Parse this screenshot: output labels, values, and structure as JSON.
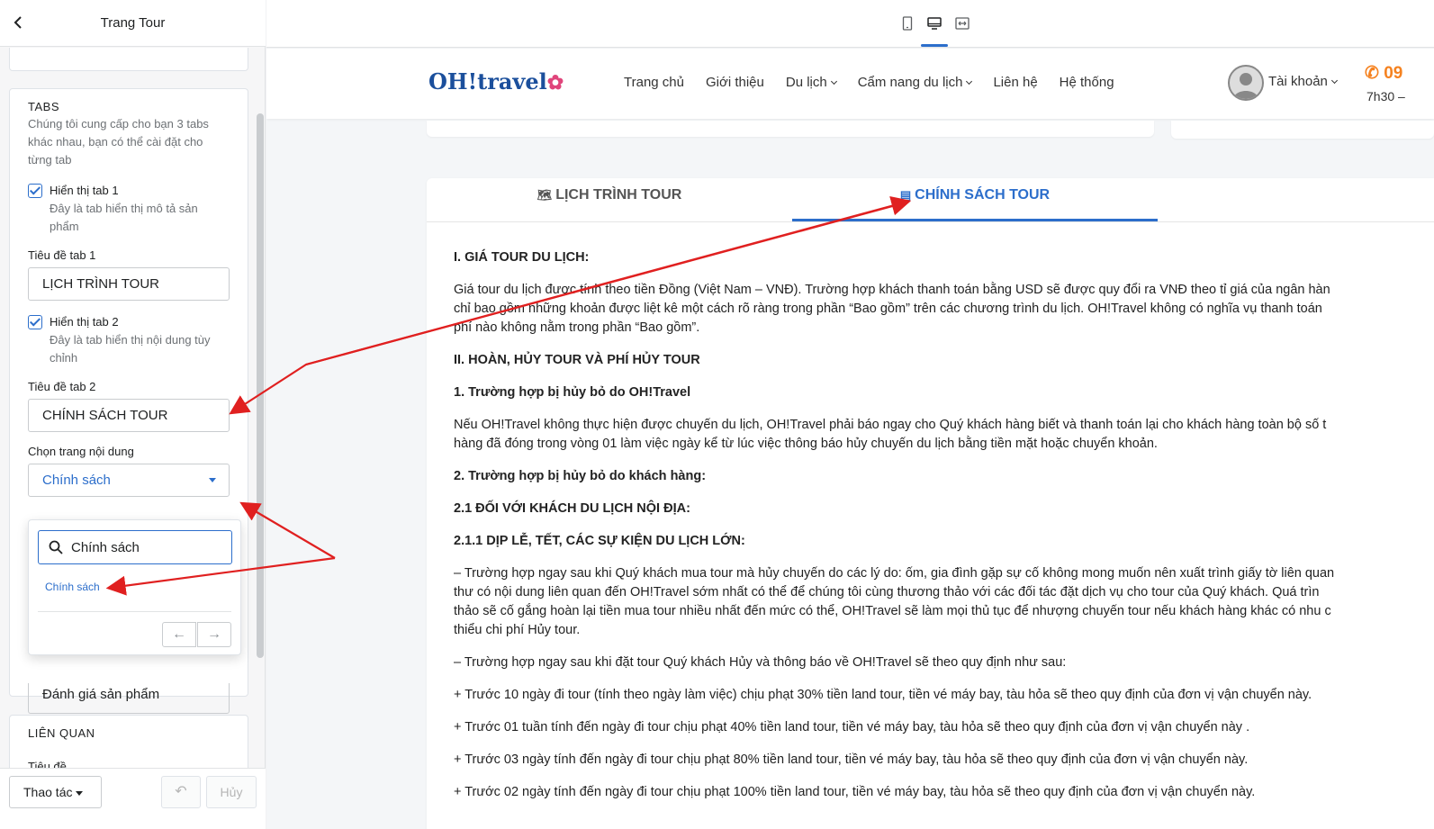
{
  "editor": {
    "title": "Trang Tour",
    "tabs_section": {
      "title": "TABS",
      "help": "Chúng tôi cung cấp cho bạn 3 tabs khác nhau, bạn có thể cài đặt cho từng tab",
      "tab1_checkbox_label": "Hiển thị tab 1",
      "tab1_checkbox_help": "Đây là tab hiển thị mô tả sản phẩm",
      "tab1_title_label": "Tiêu đề tab 1",
      "tab1_title_value": "LỊCH TRÌNH TOUR",
      "tab2_checkbox_label": "Hiển thị tab 2",
      "tab2_checkbox_help": "Đây là tab hiển thị nội dung tùy chỉnh",
      "tab2_title_label": "Tiêu đề tab 2",
      "tab2_title_value": "CHÍNH SÁCH TOUR",
      "content_page_label": "Chọn trang nội dung",
      "content_page_value": "Chính sách",
      "hidden_field_value": "Đánh giá sản phẩm"
    },
    "dropdown": {
      "search_value": "Chính sách",
      "option": "Chính sách",
      "prev": "←",
      "next": "→"
    },
    "related_section": {
      "title": "LIÊN QUAN",
      "field_label": "Tiêu đề"
    },
    "footer": {
      "actions_label": "Thao tác",
      "undo": "↶",
      "cancel": "Hủy"
    }
  },
  "site": {
    "logo_text": "OH!travel",
    "nav": [
      "Trang chủ",
      "Giới thiệu",
      "Du lịch",
      "Cẩm nang du lịch",
      "Liên hệ",
      "Hệ thống"
    ],
    "account_label": "Tài khoản",
    "phone": "09",
    "hours": "7h30 –",
    "tabs": {
      "tab1": "LỊCH TRÌNH TOUR",
      "tab2": "CHÍNH SÁCH TOUR"
    },
    "article": [
      {
        "text": "I. GIÁ TOUR DU LỊCH:",
        "bold": true
      },
      {
        "text": "Giá tour du lịch được tính theo tiền Đồng (Việt Nam – VNĐ). Trường hợp khách thanh toán bằng USD sẽ được quy đổi ra VNĐ theo tỉ giá của ngân hàn\nchỉ bao gồm những khoản được liệt kê một cách rõ ràng trong phần “Bao gồm” trên các chương trình du lịch. OH!Travel không có nghĩa vụ thanh toán\nphí nào không nằm trong phần “Bao gồm”.",
        "bold": false
      },
      {
        "text": "II. HOÀN, HỦY TOUR VÀ PHÍ HỦY TOUR",
        "bold": true
      },
      {
        "text": "1. Trường hợp bị hủy bỏ do OH!Travel",
        "bold": true
      },
      {
        "text": "Nếu OH!Travel không thực hiện được chuyến du lịch, OH!Travel phải báo ngay cho Quý khách hàng biết và thanh toán lại cho khách hàng toàn bộ số t\nhàng đã đóng trong vòng 01 làm việc ngày kể từ lúc việc thông báo hủy chuyến du lịch bằng tiền mặt hoặc chuyển khoản.",
        "bold": false
      },
      {
        "text": "2. Trường hợp bị hủy bỏ do khách hàng:",
        "bold": true
      },
      {
        "text": "2.1 ĐỐI VỚI KHÁCH DU LỊCH NỘI ĐỊA:",
        "bold": true
      },
      {
        "text": "2.1.1 DỊP LỄ, TẾT, CÁC SỰ KIỆN DU LỊCH LỚN:",
        "bold": true
      },
      {
        "text": "– Trường hợp ngay sau khi Quý khách mua tour mà hủy chuyến do các lý do: ốm, gia đình gặp sự cố không mong muốn nên xuất trình giấy tờ liên quan\nthư có nội dung liên quan đến OH!Travel sớm nhất có thể để chúng tôi cùng thương thảo với các đối tác đặt dịch vụ cho tour của Quý khách. Quá trìn\nthảo sẽ cố gắng hoàn lại tiền mua tour nhiều nhất đến mức có thể, OH!Travel sẽ làm mọi thủ tục để nhượng chuyến tour nếu khách hàng khác có nhu c\nthiểu chi phí Hủy tour.",
        "bold": false
      },
      {
        "text": "– Trường hợp ngay sau khi đặt tour Quý khách Hủy và thông báo về OH!Travel sẽ theo quy định như sau:",
        "bold": false
      },
      {
        "text": "+ Trước 10 ngày đi tour (tính theo ngày làm việc) chịu phạt 30% tiền land tour, tiền vé máy bay, tàu hỏa sẽ theo quy định của đơn vị vận chuyển này.",
        "bold": false
      },
      {
        "text": "+ Trước 01 tuần tính đến ngày đi tour chịu phạt 40% tiền land tour, tiền vé máy bay, tàu hỏa sẽ theo quy định của đơn vị vận chuyển này .",
        "bold": false
      },
      {
        "text": "+ Trước 03 ngày tính đến ngày đi tour chịu phạt 80% tiền land tour, tiền vé máy bay, tàu hỏa sẽ theo quy định của đơn vị vận chuyển này.",
        "bold": false
      },
      {
        "text": "+ Trước 02 ngày tính đến ngày đi tour chịu phạt 100% tiền land tour, tiền vé máy bay, tàu hỏa sẽ theo quy định của đơn vị vận chuyển này.",
        "bold": false
      }
    ]
  },
  "colors": {
    "accent": "#2c6ecb",
    "annotation": "#e02020",
    "brand": "#1b4f9c",
    "phone": "#f58220"
  },
  "icons": [
    "back-chevron-icon",
    "mobile-icon",
    "desktop-icon",
    "fullwidth-icon",
    "search-icon",
    "user-avatar-icon",
    "phone-icon",
    "map-icon",
    "document-icon"
  ]
}
